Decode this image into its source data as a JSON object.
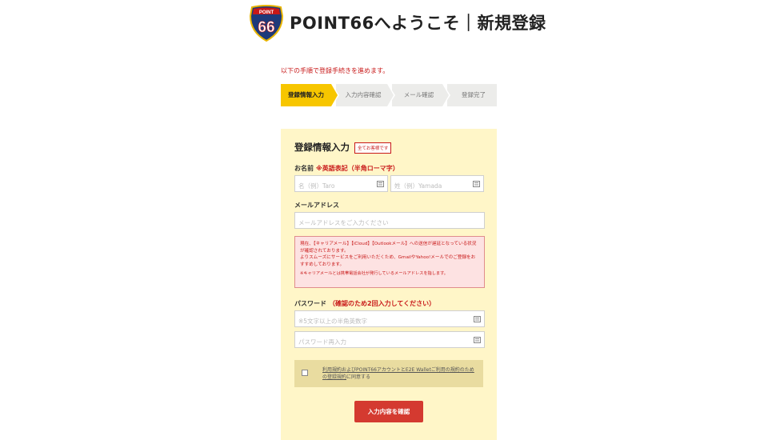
{
  "header": {
    "logo_top_text": "POINT",
    "logo_number": "66",
    "title": "POINT66へようこそ｜新規登録"
  },
  "intro": "以下の手順で登録手続きを進めます。",
  "steps": [
    {
      "label": "登録情報入力",
      "active": true
    },
    {
      "label": "入力内容確認",
      "active": false
    },
    {
      "label": "メール確認",
      "active": false
    },
    {
      "label": "登録完了",
      "active": false
    }
  ],
  "form": {
    "title": "登録情報入力",
    "required_badge": "全てお客様です",
    "name": {
      "label": "お名前",
      "note": "※英語表記（半角ローマ字）",
      "first_placeholder": "名（例）Taro",
      "last_placeholder": "姓（例）Yamada"
    },
    "email": {
      "label": "メールアドレス",
      "placeholder": "メールアドレスをご入力ください"
    },
    "warning": {
      "line1": "現在、【キャリアメール】【iCloud】【Outlookメール】への送信が遅延となっている状況が確認されております。",
      "line2": "よりスムーズにサービスをご利用いただくため、GmailやYahoo!メールでのご登録をおすすめしております。",
      "line3": "※キャリアメールとは携帯電話会社が発行しているメールアドレスを指します。"
    },
    "password": {
      "label": "パスワード",
      "note": "（確認のため2回入力してください）",
      "placeholder": "※5文字以上の半角英数字",
      "confirm_placeholder": "パスワード再入力"
    },
    "agreement": {
      "link_text": "利用規約およびPOINT66アカウントとE2E Walletご利用の規約のための登録規約",
      "suffix": "に同意する"
    },
    "submit_label": "入力内容を確認"
  }
}
